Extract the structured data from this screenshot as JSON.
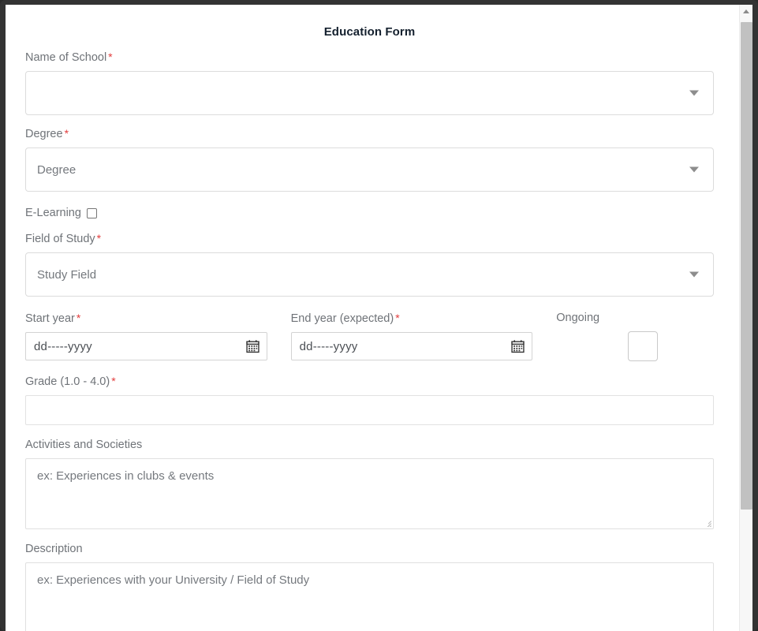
{
  "window": {
    "frame_color": "#333333",
    "page_background": "#ffffff"
  },
  "form": {
    "title": "Education Form",
    "required_marker": "*",
    "accent_required_color": "#e23c3c",
    "label_color": "#6f7378",
    "fields": {
      "school": {
        "label": "Name of School",
        "required": true,
        "value": "",
        "placeholder": "",
        "type": "select-input",
        "icon": "chevron-down-icon"
      },
      "degree": {
        "label": "Degree",
        "required": true,
        "value": "",
        "placeholder": "Degree",
        "type": "select",
        "icon": "chevron-down-icon"
      },
      "elearning": {
        "label": "E-Learning",
        "required": false,
        "checked": false,
        "type": "checkbox"
      },
      "field_of_study": {
        "label": "Field of Study",
        "required": true,
        "value": "",
        "placeholder": "Study Field",
        "type": "select",
        "icon": "chevron-down-icon"
      },
      "start_year": {
        "label": "Start year",
        "required": true,
        "value": "",
        "placeholder": "dd-----yyyy",
        "type": "date",
        "icon": "calendar-icon"
      },
      "end_year": {
        "label": "End year (expected)",
        "required": true,
        "value": "",
        "placeholder": "dd-----yyyy",
        "type": "date",
        "icon": "calendar-icon"
      },
      "ongoing": {
        "label": "Ongoing",
        "required": false,
        "checked": false,
        "type": "checkbox"
      },
      "grade": {
        "label": "Grade (1.0 - 4.0)",
        "required": true,
        "value": "",
        "placeholder": "",
        "type": "text"
      },
      "activities": {
        "label": "Activities and Societies",
        "required": false,
        "value": "",
        "placeholder": "ex: Experiences in clubs & events",
        "type": "textarea"
      },
      "description": {
        "label": "Description",
        "required": false,
        "value": "",
        "placeholder": "ex: Experiences with your University / Field of Study",
        "type": "textarea"
      }
    }
  },
  "scrollbar": {
    "up_arrow_icon": "scroll-up-arrow-icon",
    "thumb_color": "#c1c1c1",
    "track_color": "#f7f7f7"
  }
}
